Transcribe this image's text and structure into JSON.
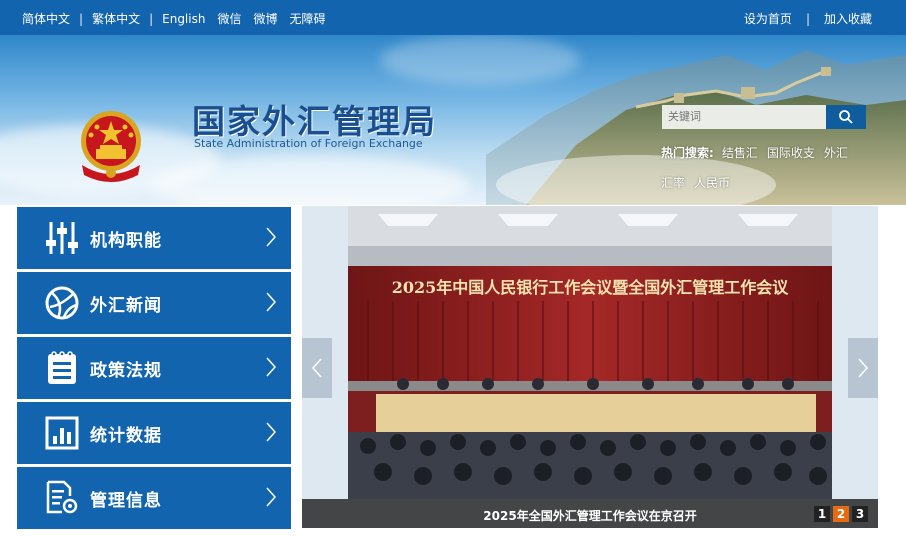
{
  "topbar": {
    "simplified": "简体中文",
    "traditional": "繁体中文",
    "english": "English",
    "wechat": "微信",
    "weibo": "微博",
    "accessible": "无障碍",
    "set_home": "设为首页",
    "add_favorite": "加入收藏",
    "separator": "|"
  },
  "header": {
    "title": "国家外汇管理局",
    "subtitle": "State Administration of Foreign Exchange",
    "search_placeholder": "关键词",
    "hot_label": "热门搜索:",
    "hot_terms": [
      "结售汇",
      "国际收支",
      "外汇",
      "汇率",
      "人民币"
    ]
  },
  "menu": {
    "items": [
      {
        "label": "机构职能",
        "icon": "sliders-icon"
      },
      {
        "label": "外汇新闻",
        "icon": "globe-icon"
      },
      {
        "label": "政策法规",
        "icon": "document-icon"
      },
      {
        "label": "统计数据",
        "icon": "chart-icon"
      },
      {
        "label": "管理信息",
        "icon": "settings-doc-icon"
      }
    ]
  },
  "slider": {
    "banner_text": "2025年中国人民银行工作会议暨全国外汇管理工作会议",
    "caption": "2025年全国外汇管理工作会议在京召开",
    "pages": [
      "1",
      "2",
      "3"
    ],
    "active_page": 2
  },
  "colors": {
    "primary": "#1364ae",
    "active_dot": "#e66a10"
  }
}
